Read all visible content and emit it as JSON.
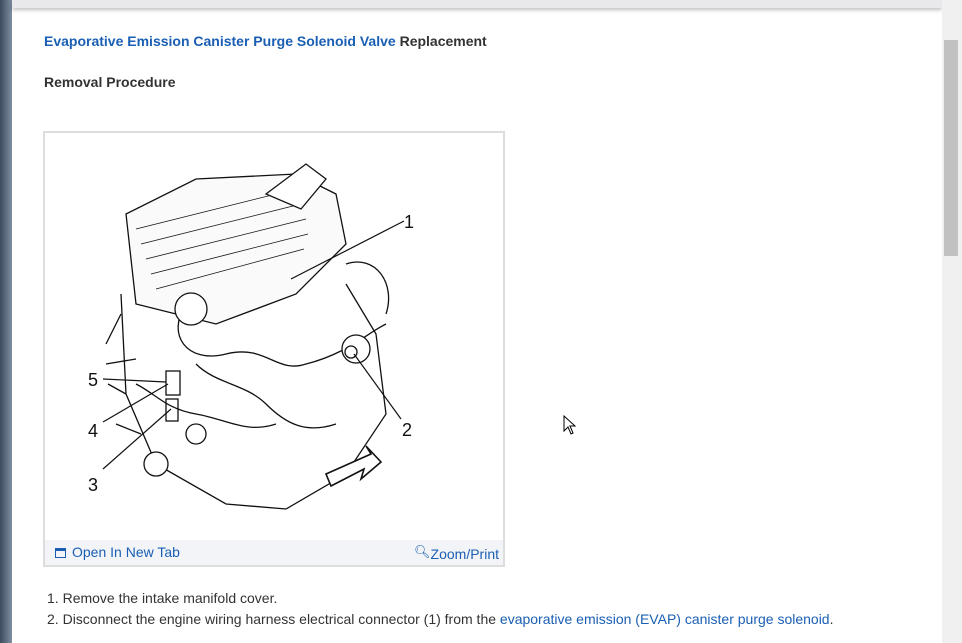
{
  "heading": {
    "link": "Evaporative Emission Canister Purge Solenoid Valve",
    "rest": " Replacement"
  },
  "subheading": "Removal Procedure",
  "figure": {
    "callouts": [
      "1",
      "2",
      "3",
      "4",
      "5"
    ],
    "open_tab": "Open In New Tab",
    "zoom": "Zoom/Print"
  },
  "steps": [
    {
      "num": "1.",
      "text": "Remove the intake manifold cover."
    },
    {
      "num": "2.",
      "pre": "Disconnect the engine wiring harness electrical connector (1) from the ",
      "link": "evaporative emission (EVAP) canister purge solenoid",
      "post": "."
    }
  ]
}
